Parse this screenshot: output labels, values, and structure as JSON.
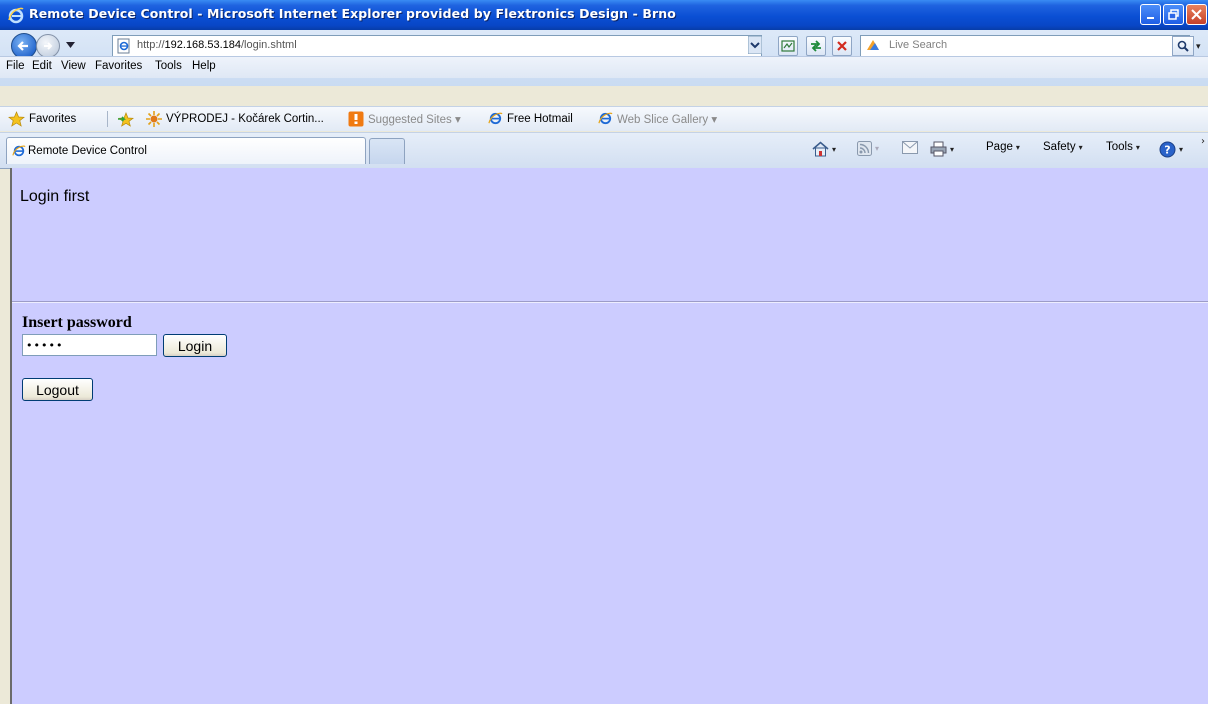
{
  "window": {
    "title": "Remote Device Control - Microsoft Internet Explorer provided by Flextronics Design - Brno",
    "controls": [
      "minimize",
      "maximize",
      "close"
    ]
  },
  "address_bar": {
    "url_prefix": "http://",
    "url_host": "192.168.53.184",
    "url_path": "/login.shtml"
  },
  "search": {
    "placeholder": "Live Search"
  },
  "menu": {
    "items": [
      "File",
      "Edit",
      "View",
      "Favorites",
      "Tools",
      "Help"
    ]
  },
  "favorites_bar": {
    "favorites_label": "Favorites",
    "links": [
      {
        "label": "VÝPRODEJ - Kočárek Cortin...",
        "icon": "star-burst-icon"
      },
      {
        "label": "Suggested Sites ▾",
        "icon": "suggested-sites-icon"
      },
      {
        "label": "Free Hotmail",
        "icon": "ie-page-icon"
      },
      {
        "label": "Web Slice Gallery ▾",
        "icon": "ie-page-icon"
      }
    ]
  },
  "tabs": [
    {
      "label": "Remote Device Control",
      "active": true
    }
  ],
  "command_bar": {
    "page": "Page",
    "safety": "Safety",
    "tools": "Tools"
  },
  "page": {
    "background": "#ccccff",
    "heading": "Login first",
    "form_label": "Insert password",
    "password_mask": "•••••",
    "login_button": "Login",
    "logout_button": "Logout"
  }
}
